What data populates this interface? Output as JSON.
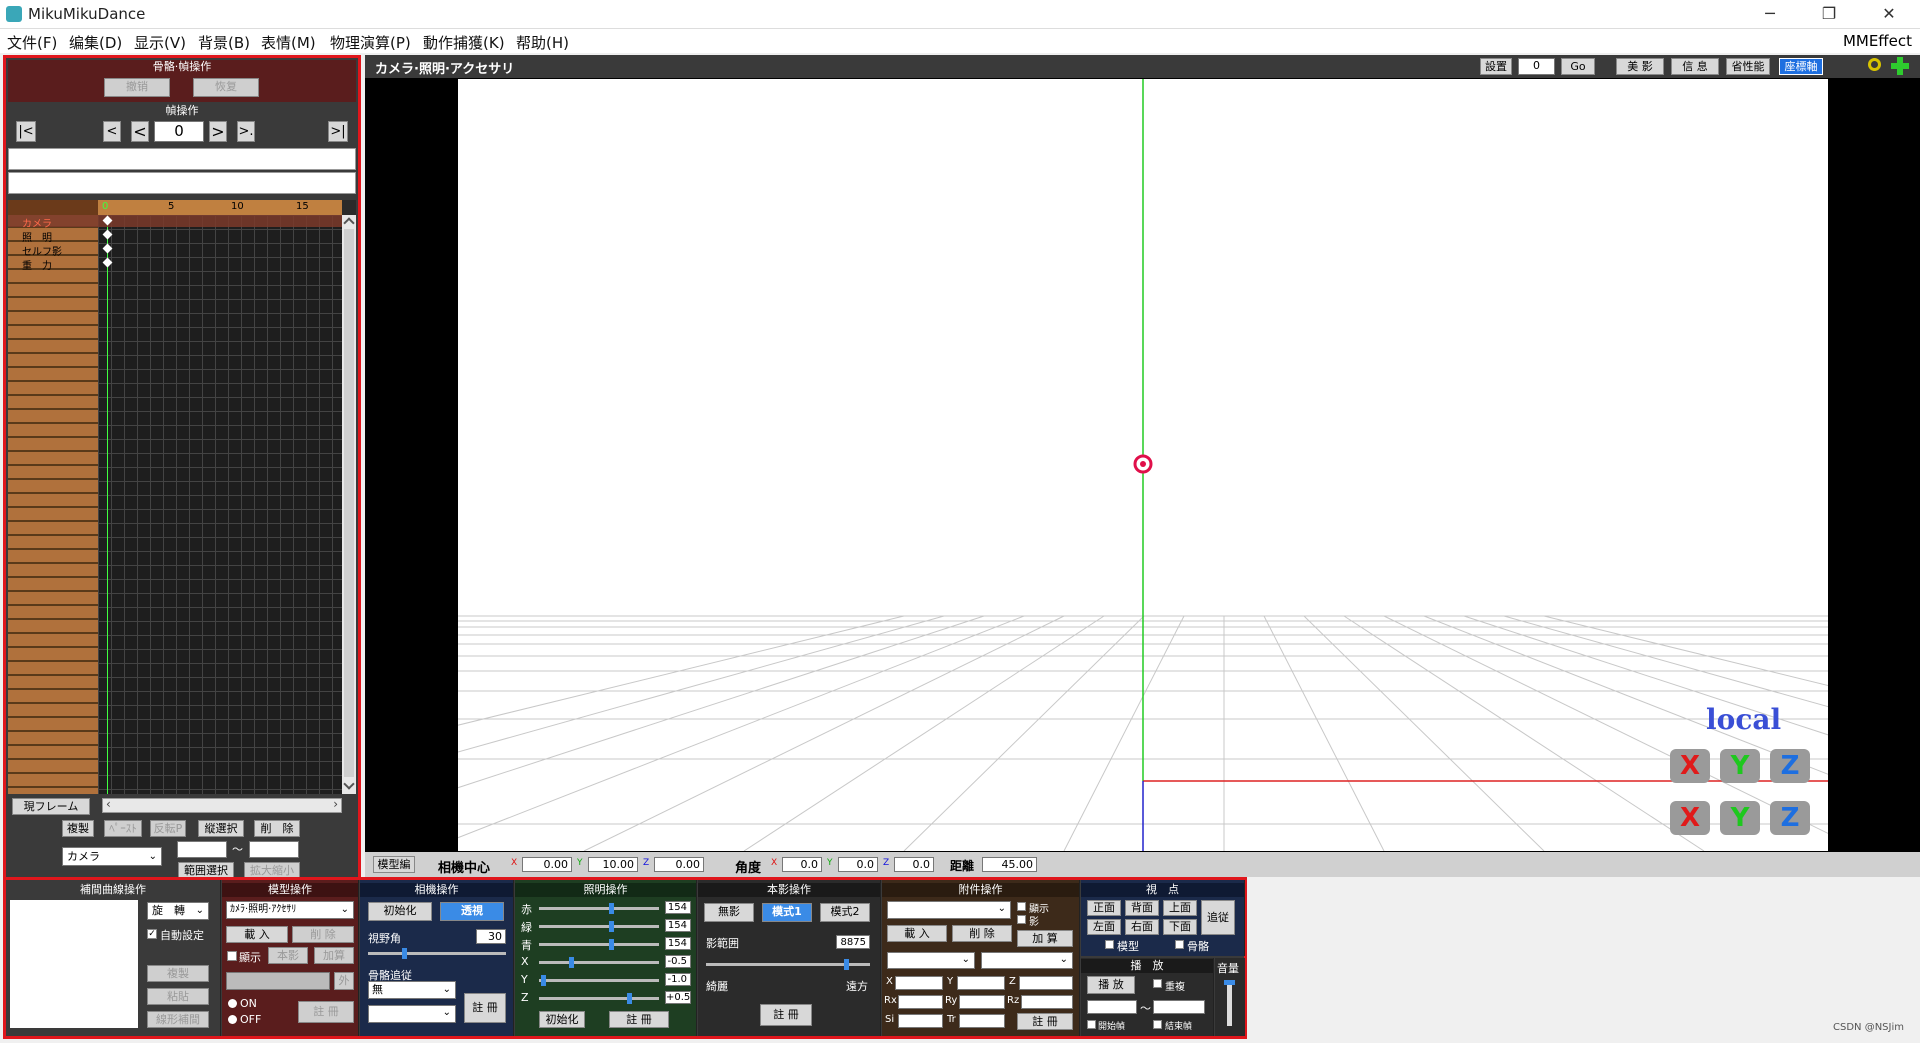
{
  "window": {
    "title": "MikuMikuDance",
    "minimize": "─",
    "maximize": "❐",
    "close": "✕"
  },
  "menu": {
    "items": [
      "文件(F)",
      "编集(D)",
      "显示(V)",
      "背景(B)",
      "表情(M)",
      "物理演算(P)",
      "動作捕獲(K)",
      "帮助(H)"
    ],
    "right": "MMEffect"
  },
  "left": {
    "bone_frame_header": "骨骼·幀操作",
    "undo": "撤销",
    "redo": "恢复",
    "frame_header": "幀操作",
    "nav_first": "|<",
    "nav_prev_key": "<",
    "nav_prev": "<",
    "frame_value": "0",
    "nav_next": ">",
    "nav_next_key": ">.",
    "nav_last": ">|",
    "ruler_ticks": [
      "0",
      "5",
      "10",
      "15"
    ],
    "track_labels": [
      "カメラ",
      "照　明",
      "セルフ影",
      "重　力"
    ],
    "current_frame": "現フレーム",
    "copy": "複製",
    "paste": "ﾍﾟｰｽﾄ",
    "reverse_paste": "反転P",
    "vertical_select": "縦選択",
    "delete": "削　除",
    "camera_select": "カメラ",
    "tilde": "～",
    "range_select": "範囲選択",
    "expand_shrink": "拡大縮小"
  },
  "viewport": {
    "title": "カメラ·照明·アクセサリ",
    "settings": "設置",
    "settings_value": "0",
    "go": "Go",
    "beauty": "美 影",
    "info": "信 息",
    "power_save": "省性能",
    "coord_axis": "座標軸",
    "local_label": "local",
    "axis_buttons": [
      "X",
      "Y",
      "Z",
      "X",
      "Y",
      "Z"
    ]
  },
  "status": {
    "model_edit": "模型編",
    "camera_center": "相機中心",
    "x_label": "X",
    "x_value": "0.00",
    "y_label": "Y",
    "y_value": "10.00",
    "z_label": "Z",
    "z_value": "0.00",
    "angle": "角度",
    "ax_value": "0.0",
    "ay_value": "0.0",
    "az_value": "0.0",
    "distance": "距離",
    "distance_value": "45.00"
  },
  "bottom": {
    "interp": {
      "title": "補間曲線操作",
      "rotate": "旋　轉",
      "auto": "自動設定",
      "copy": "複製",
      "paste": "粘貼",
      "linear": "線形補間"
    },
    "model": {
      "title": "模型操作",
      "selected": "ｶﾒﾗ·照明·ｱｸｾｻﾘ",
      "load": "載 入",
      "delete": "削 除",
      "show": "顯示",
      "body": "本影",
      "add": "加算",
      "outer": "外",
      "on": "ON",
      "off": "OFF",
      "register": "註 冊"
    },
    "camera": {
      "title": "相機操作",
      "init": "初始化",
      "perspective": "透視",
      "fov_label": "視野角",
      "fov_value": "30",
      "bone_follow": "骨骼追従",
      "follow_value": "無",
      "register": "註 冊"
    },
    "lighting": {
      "title": "照明操作",
      "r_label": "赤",
      "r_value": "154",
      "g_label": "緑",
      "g_value": "154",
      "b_label": "青",
      "b_value": "154",
      "x_label": "X",
      "x_value": "-0.5",
      "y_label": "Y",
      "y_value": "-1.0",
      "z_label": "Z",
      "z_value": "+0.5",
      "init": "初始化",
      "register": "註 冊"
    },
    "shadow": {
      "title": "本影操作",
      "none": "無影",
      "mode1": "模式1",
      "mode2": "模式2",
      "range_label": "影範囲",
      "range_value": "8875",
      "near": "綺麗",
      "far": "遠方",
      "register": "註 冊"
    },
    "accessory": {
      "title": "附件操作",
      "show": "顯示",
      "shadow": "影",
      "load": "載 入",
      "delete": "削 除",
      "add": "加 算",
      "x": "X",
      "y": "Y",
      "z": "Z",
      "rx": "Rx",
      "ry": "Ry",
      "rz": "Rz",
      "si": "Si",
      "tr": "Tr",
      "register": "註 冊"
    },
    "view": {
      "title": "視　点",
      "front": "正面",
      "back": "背面",
      "top": "上面",
      "follow": "追従",
      "left": "左面",
      "right": "右面",
      "bottom": "下面",
      "model": "模型",
      "bone": "骨骼"
    },
    "play": {
      "title": "播　放",
      "play": "播 放",
      "repeat": "重複",
      "start_frame": "開始幀",
      "end_frame": "結束幀",
      "tilde": "～",
      "volume": "音量"
    }
  },
  "watermark": "CSDN @NSJim",
  "colors": {
    "accent_red": "#e0161c",
    "header_maroon": "#5a1d1d",
    "axis_green": "#22cc22",
    "axis_blue": "#2222cc",
    "axis_red": "#dd2222",
    "local_blue": "#3a4fd6"
  }
}
